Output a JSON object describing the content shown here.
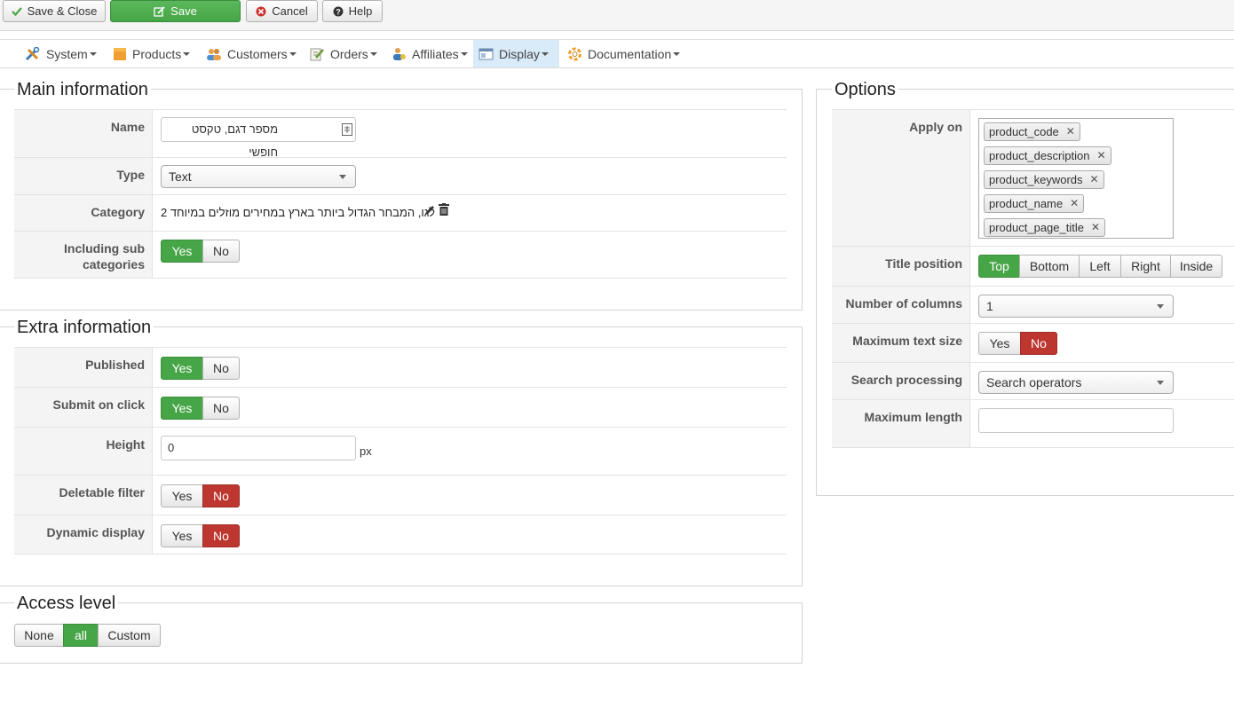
{
  "toolbar": {
    "save_close": "Save & Close",
    "save": "Save",
    "cancel": "Cancel",
    "help": "Help"
  },
  "menu": {
    "items": [
      {
        "label": "System",
        "icon": "tools-icon"
      },
      {
        "label": "Products",
        "icon": "box-icon"
      },
      {
        "label": "Customers",
        "icon": "users-icon"
      },
      {
        "label": "Orders",
        "icon": "edit-icon"
      },
      {
        "label": "Affiliates",
        "icon": "affiliates-icon"
      },
      {
        "label": "Display",
        "icon": "display-icon",
        "active": true
      },
      {
        "label": "Documentation",
        "icon": "lifebuoy-icon"
      }
    ]
  },
  "main_info": {
    "legend": "Main information",
    "name_label": "Name",
    "name_value": "מספר דגם, טקסט חופשי",
    "type_label": "Type",
    "type_value": "Text",
    "category_label": "Category",
    "category_value": "לגו, המבחר הגדול ביותר בארץ במחירים מוזלים במיוחד 2",
    "sub_label": "Including sub categories",
    "sub_yes": "Yes",
    "sub_no": "No"
  },
  "extra_info": {
    "legend": "Extra information",
    "published_label": "Published",
    "submit_label": "Submit on click",
    "height_label": "Height",
    "height_value": "0",
    "height_unit": "px",
    "deletable_label": "Deletable filter",
    "dynamic_label": "Dynamic display",
    "yes": "Yes",
    "no": "No"
  },
  "access": {
    "legend": "Access level",
    "none": "None",
    "all": "all",
    "custom": "Custom"
  },
  "options": {
    "legend": "Options",
    "apply_label": "Apply on",
    "apply_tags": [
      "product_code",
      "product_description",
      "product_keywords",
      "product_name",
      "product_page_title"
    ],
    "title_pos_label": "Title position",
    "title_pos": [
      "Top",
      "Bottom",
      "Left",
      "Right",
      "Inside"
    ],
    "columns_label": "Number of columns",
    "columns_value": "1",
    "max_text_label": "Maximum text size",
    "yes": "Yes",
    "no": "No",
    "search_label": "Search processing",
    "search_value": "Search operators",
    "max_len_label": "Maximum length",
    "max_len_value": ""
  },
  "colors": {
    "green": "#46a546",
    "red": "#bd362f",
    "active_menu": "#d9ebf8"
  }
}
